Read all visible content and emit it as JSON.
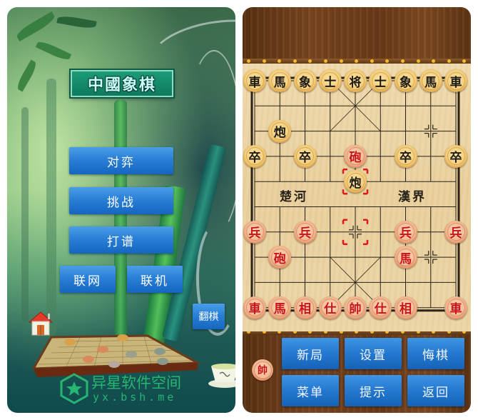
{
  "menu_screen": {
    "title": "中國象棋",
    "buttons": {
      "vs": "对弈",
      "challenge": "挑战",
      "record": "打谱",
      "online": "联网",
      "bluetooth": "联机",
      "flip": "翻棋"
    },
    "home_icon": "home-icon",
    "watermark": {
      "title": "异星软件空间",
      "url": "yx.bsh.me"
    }
  },
  "board_screen": {
    "river": {
      "left": "楚河",
      "right": "漢界"
    },
    "selected_piece": "炮",
    "turn_indicator": "帥",
    "colors": {
      "black_piece_text": "#1e1a14",
      "red_piece_text": "#c8141a",
      "button_blue": "#2478cf",
      "selection_marker": "#e01818"
    },
    "pieces": [
      {
        "side": "black",
        "label": "車",
        "col": 0,
        "row": 0
      },
      {
        "side": "black",
        "label": "馬",
        "col": 1,
        "row": 0
      },
      {
        "side": "black",
        "label": "象",
        "col": 2,
        "row": 0
      },
      {
        "side": "black",
        "label": "士",
        "col": 3,
        "row": 0
      },
      {
        "side": "black",
        "label": "将",
        "col": 4,
        "row": 0
      },
      {
        "side": "black",
        "label": "士",
        "col": 5,
        "row": 0
      },
      {
        "side": "black",
        "label": "象",
        "col": 6,
        "row": 0
      },
      {
        "side": "black",
        "label": "馬",
        "col": 7,
        "row": 0
      },
      {
        "side": "black",
        "label": "車",
        "col": 8,
        "row": 0
      },
      {
        "side": "black",
        "label": "炮",
        "col": 1,
        "row": 2
      },
      {
        "side": "black",
        "label": "卒",
        "col": 0,
        "row": 3
      },
      {
        "side": "black",
        "label": "卒",
        "col": 2,
        "row": 3
      },
      {
        "side": "red",
        "label": "砲",
        "col": 4,
        "row": 3
      },
      {
        "side": "black",
        "label": "卒",
        "col": 6,
        "row": 3
      },
      {
        "side": "black",
        "label": "卒",
        "col": 8,
        "row": 3
      },
      {
        "side": "black",
        "label": "炮",
        "col": 4,
        "row": 4,
        "selected": true
      },
      {
        "side": "red",
        "label": "兵",
        "col": 0,
        "row": 6
      },
      {
        "side": "red",
        "label": "兵",
        "col": 2,
        "row": 6
      },
      {
        "side": "red",
        "label": "兵",
        "col": 6,
        "row": 6
      },
      {
        "side": "red",
        "label": "兵",
        "col": 8,
        "row": 6
      },
      {
        "side": "red",
        "label": "砲",
        "col": 1,
        "row": 7
      },
      {
        "side": "red",
        "label": "馬",
        "col": 6,
        "row": 7
      },
      {
        "side": "red",
        "label": "車",
        "col": 0,
        "row": 9
      },
      {
        "side": "red",
        "label": "馬",
        "col": 1,
        "row": 9
      },
      {
        "side": "red",
        "label": "相",
        "col": 2,
        "row": 9
      },
      {
        "side": "red",
        "label": "仕",
        "col": 3,
        "row": 9
      },
      {
        "side": "red",
        "label": "帥",
        "col": 4,
        "row": 9
      },
      {
        "side": "red",
        "label": "仕",
        "col": 5,
        "row": 9
      },
      {
        "side": "red",
        "label": "相",
        "col": 6,
        "row": 9
      },
      {
        "side": "red",
        "label": "車",
        "col": 8,
        "row": 9
      }
    ],
    "last_move_from": {
      "col": 4,
      "row": 6
    },
    "controls": {
      "new_game": "新局",
      "settings": "设置",
      "undo": "悔棋",
      "menu": "菜单",
      "hint": "提示",
      "back": "返回"
    }
  }
}
